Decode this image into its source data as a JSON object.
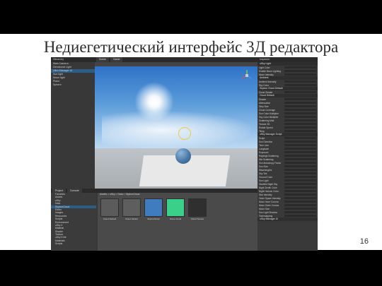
{
  "slide": {
    "title": "Недиегетический интерфейс 3Д редактора",
    "page_number": "16"
  },
  "hierarchy": {
    "tab_label": "Hierarchy",
    "items": [
      {
        "label": "Main Camera",
        "selected": false
      },
      {
        "label": "Directional Light",
        "selected": false
      },
      {
        "label": "Ultra Manager UI",
        "selected": true
      },
      {
        "label": "Sun light",
        "selected": false
      },
      {
        "label": "Moon light",
        "selected": false
      },
      {
        "label": "Plane",
        "selected": false
      },
      {
        "label": "Sphere",
        "selected": false
      }
    ]
  },
  "scene": {
    "tabs": [
      "Scene",
      "Game"
    ]
  },
  "project": {
    "tabs": [
      "Project",
      "Console"
    ],
    "breadcrumb": "Assets > uSky > Data > SkyboxCloud",
    "tree": [
      {
        "label": "Favorites",
        "selected": false
      },
      {
        "label": "Assets",
        "selected": false
      },
      {
        "label": "uSky",
        "selected": false
      },
      {
        "label": "Data",
        "selected": false
      },
      {
        "label": "SkyboxCloud",
        "selected": true
      },
      {
        "label": "Editor",
        "selected": false
      },
      {
        "label": "Images",
        "selected": false
      },
      {
        "label": "Resources",
        "selected": false
      },
      {
        "label": "Scripts",
        "selected": false
      },
      {
        "label": "Environment",
        "selected": false
      },
      {
        "label": "uSky 4",
        "selected": false
      },
      {
        "label": "Material",
        "selected": false
      },
      {
        "label": "Shader",
        "selected": false
      },
      {
        "label": "Texture",
        "selected": false
      },
      {
        "label": "uSky 5 lite",
        "selected": false
      },
      {
        "label": "Materials",
        "selected": false
      },
      {
        "label": "Scripts",
        "selected": false
      }
    ],
    "assets": [
      {
        "label": "Cloud Default",
        "thumb": "#5b5b5b"
      },
      {
        "label": "Cloud Variant",
        "thumb": "#5e5e5e"
      },
      {
        "label": "SkyboxScript",
        "thumb": "#3f7bbf"
      },
      {
        "label": "Noise Cloud",
        "thumb": "#3ad08a"
      },
      {
        "label": "Cloud Texture",
        "thumb": "#2f2f2f"
      }
    ]
  },
  "inspector": {
    "tab_label": "Inspector",
    "sections": [
      {
        "header": "uSky Light",
        "rows": [
          "Light Color",
          "Enable Moon Lighting",
          "Moon Intensity"
        ]
      },
      {
        "header": "Ambient",
        "rows": [
          "Ambient Intensity",
          "Sky Color"
        ]
      },
      {
        "header": "Skybox Cloud Default",
        "rows": [
          "Cloud Shader"
        ]
      },
      {
        "header": "Cloud Default",
        "rows": [
          "Shader",
          "Attenuation",
          "Step Size",
          "Cloud Coverage",
          "Sun Color Multiplier",
          "Sky Color Multiplier",
          "Scattering Mult",
          "Texture 2D",
          "Rotate Speed",
          "Tiling"
        ]
      },
      {
        "header": "uSky Manager Script",
        "rows": [
          "Script",
          "Sun Direction",
          "Time Line",
          "Longitude",
          "Exposure",
          "Rayleigh Scattering",
          "Mie Scattering",
          "Sun Anisotropy Factor",
          "Sun Size",
          "Wavelengths",
          "Sky Tint",
          "Ground Color",
          "Sun Light",
          "Starfield Night Sky",
          "Night Zenith Color",
          "Night Horizon Color",
          "Star Intensity",
          "Outer Space Intensity",
          "Moon Inner Corona",
          "Moon Outer Corona",
          "Moon Size",
          "Sun Light Shadow",
          "Tonemapping"
        ]
      },
      {
        "header": "uSky Manager UI",
        "rows": []
      }
    ]
  },
  "colors": {
    "editor_bg": "#3c3c3c",
    "selection": "#2c5d87"
  }
}
